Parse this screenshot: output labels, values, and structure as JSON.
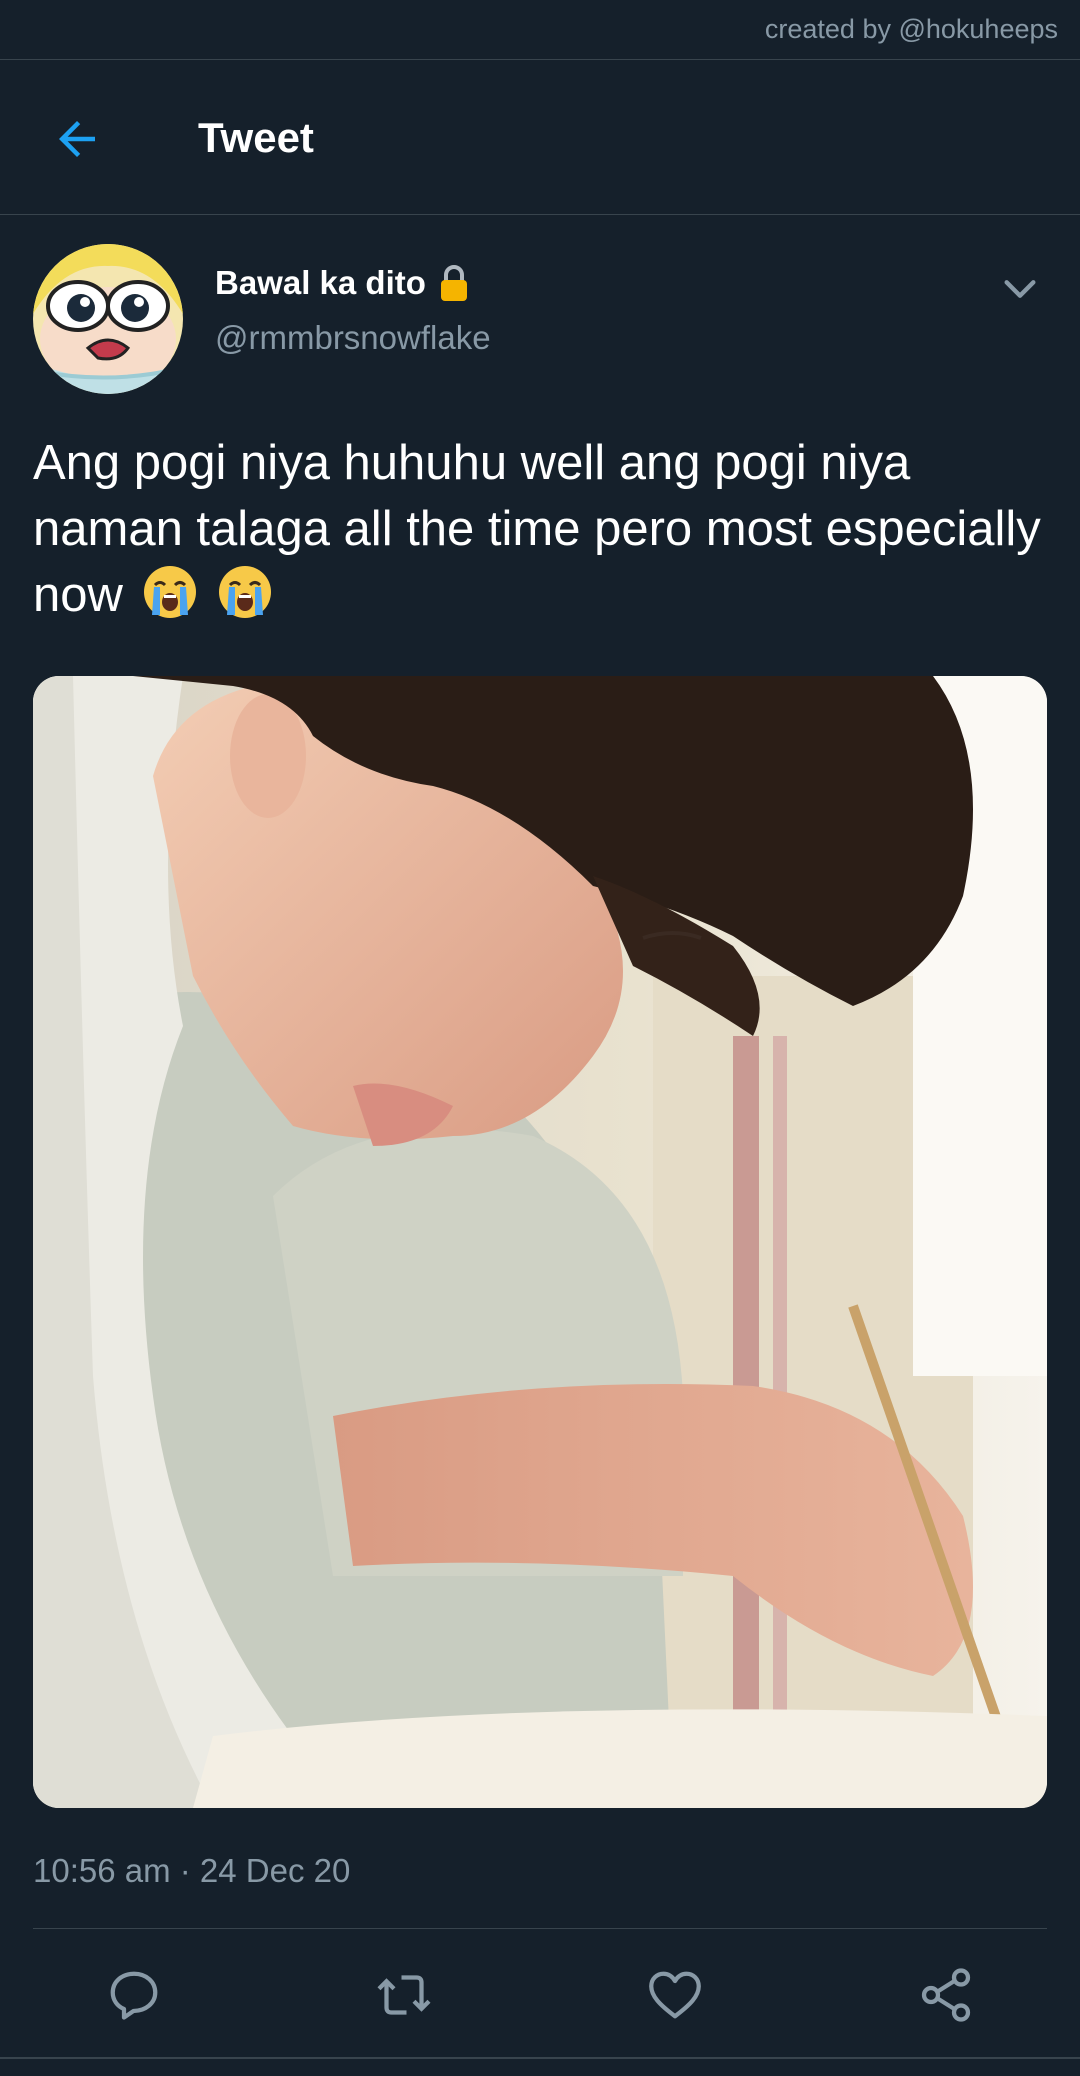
{
  "credit": "created by @hokuheeps",
  "header": {
    "title": "Tweet",
    "back_icon": "arrow-left-icon"
  },
  "author": {
    "display_name": "Bawal ka dito",
    "handle": "@rmmbrsnowflake",
    "protected_icon": "lock-icon",
    "menu_icon": "chevron-down-icon"
  },
  "tweet": {
    "text": "Ang pogi niya huhuhu well ang pogi niya naman talaga all the time pero most especially now",
    "emojis": [
      "loudly-crying-face",
      "loudly-crying-face"
    ],
    "timestamp": "10:56 am · 24 Dec 20"
  },
  "actions": [
    {
      "name": "reply",
      "icon": "reply-icon"
    },
    {
      "name": "retweet",
      "icon": "retweet-icon"
    },
    {
      "name": "like",
      "icon": "heart-icon"
    },
    {
      "name": "share",
      "icon": "share-icon"
    }
  ],
  "colors": {
    "background": "#15202b",
    "accent": "#1da1f2",
    "secondary_text": "#8899a6",
    "border": "#38444d"
  }
}
